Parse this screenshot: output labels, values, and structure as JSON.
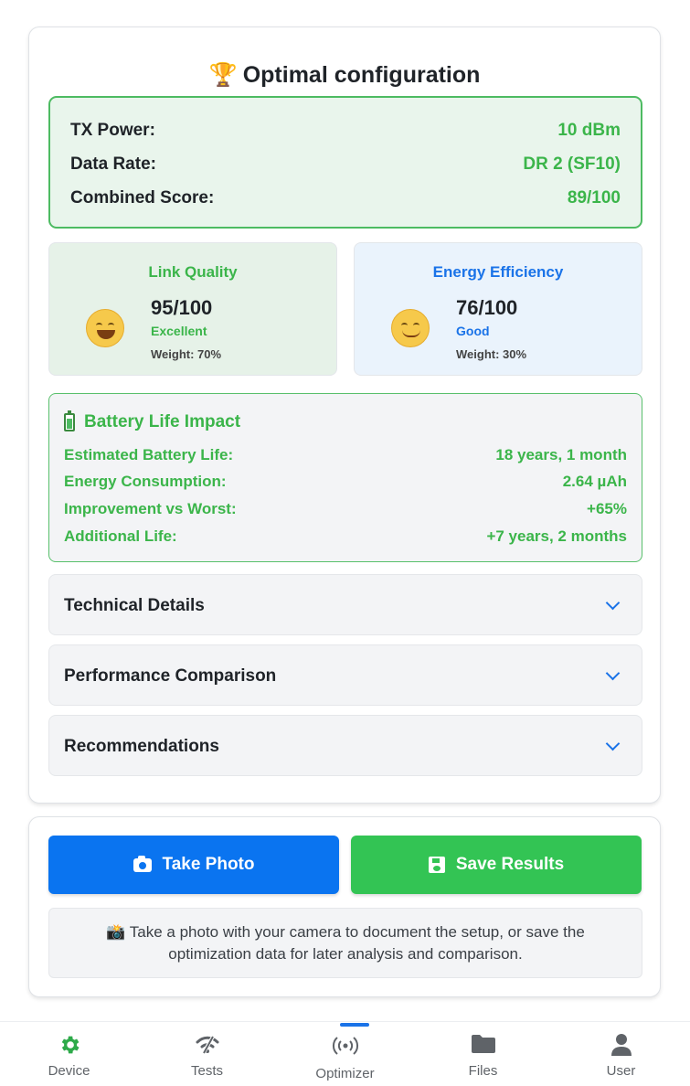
{
  "optimal": {
    "title": "Optimal configuration",
    "trophy_icon": "🏆",
    "tx_power_label": "TX Power:",
    "tx_power_value": "10 dBm",
    "data_rate_label": "Data Rate:",
    "data_rate_value": "DR 2 (SF10)",
    "combined_label": "Combined Score:",
    "combined_value": "89/100"
  },
  "link_quality": {
    "title": "Link Quality",
    "value": "95/100",
    "status": "Excellent",
    "weight": "Weight: 70%",
    "face_icon": "grinning-face-icon"
  },
  "energy_efficiency": {
    "title": "Energy Efficiency",
    "value": "76/100",
    "status": "Good",
    "weight": "Weight: 30%",
    "face_icon": "smiling-face-icon"
  },
  "battery": {
    "title": "Battery Life Impact",
    "rows": [
      {
        "label": "Estimated Battery Life:",
        "value": "18 years, 1 month"
      },
      {
        "label": "Energy Consumption:",
        "value": "2.64 µAh"
      },
      {
        "label": "Improvement vs Worst:",
        "value": "+65%"
      },
      {
        "label": "Additional Life:",
        "value": "+7 years, 2 months"
      }
    ]
  },
  "accordions": [
    {
      "label": "Technical Details"
    },
    {
      "label": "Performance Comparison"
    },
    {
      "label": "Recommendations"
    }
  ],
  "actions": {
    "take_photo": "Take Photo",
    "save_results": "Save Results",
    "info_emoji": "📸",
    "info_text": "Take a photo with your camera to document the setup, or save the optimization data for later analysis and comparison."
  },
  "nav": {
    "items": [
      {
        "label": "Device",
        "icon": "gear-icon"
      },
      {
        "label": "Tests",
        "icon": "wifi-off-icon"
      },
      {
        "label": "Optimizer",
        "icon": "radio-signal-icon"
      },
      {
        "label": "Files",
        "icon": "folder-icon"
      },
      {
        "label": "User",
        "icon": "user-icon"
      }
    ],
    "active": "Optimizer"
  },
  "colors": {
    "green": "#3bb54a",
    "blue": "#1a73e8",
    "photo_button": "#0a74f0",
    "save_button": "#33c454",
    "active_nav": "#1a73e8"
  }
}
